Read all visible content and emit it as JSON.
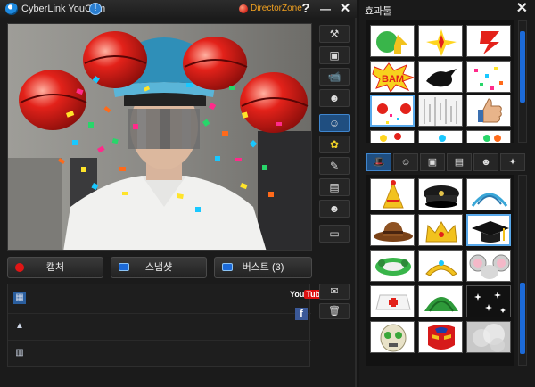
{
  "main_window": {
    "title": "CyberLink YouCam",
    "director_zone": "DirectorZone",
    "help_label": "?",
    "minimize_label": "—",
    "close_label": "✕"
  },
  "side_tools": [
    {
      "name": "tools-icon",
      "glyph": "⚒"
    },
    {
      "name": "fullscreen-icon",
      "glyph": "▣"
    },
    {
      "name": "surveillance-camera-icon",
      "glyph": "📹"
    },
    {
      "name": "add-avatar-icon",
      "glyph": "☻"
    },
    {
      "name": "avatar-effects-icon",
      "glyph": "☺"
    },
    {
      "name": "flower-effects-icon",
      "glyph": "✿"
    },
    {
      "name": "pen-icon",
      "glyph": "✎"
    },
    {
      "name": "frame-add-icon",
      "glyph": "▤"
    },
    {
      "name": "face-add-icon",
      "glyph": "☻"
    },
    {
      "name": "eraser-icon",
      "glyph": "▭"
    }
  ],
  "capture_buttons": {
    "capture": "캡처",
    "snapshot": "스냅샷",
    "burst": "버스트 (3)"
  },
  "library": {
    "youtube_label": "YouTube",
    "facebook_label": "f"
  },
  "effects_panel": {
    "title": "효과툴",
    "close_label": "✕",
    "tabs": [
      {
        "name": "hat-tab",
        "glyph": "🎩"
      },
      {
        "name": "avatar-tab",
        "glyph": "☺"
      },
      {
        "name": "frame-tab",
        "glyph": "▣"
      },
      {
        "name": "scene-tab",
        "glyph": "▤"
      },
      {
        "name": "face-tab",
        "glyph": "☻"
      },
      {
        "name": "magic-tab",
        "glyph": "✦"
      }
    ]
  },
  "colors": {
    "accent_blue": "#1c6ad8",
    "director_zone": "#f0a020",
    "capture_red": "#e01515"
  }
}
